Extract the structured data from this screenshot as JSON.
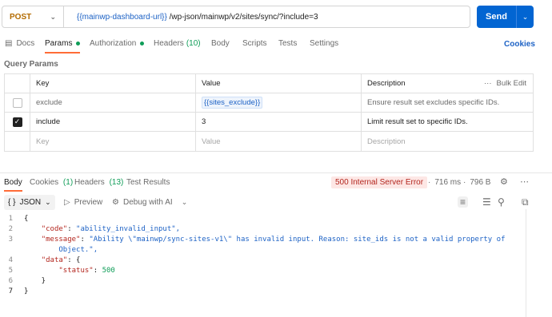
{
  "request": {
    "method": "POST",
    "url_variable": "{{mainwp-dashboard-url}}",
    "url_rest": "/wp-json/mainwp/v2/sites/sync/?include=3",
    "send_label": "Send"
  },
  "tabs": [
    {
      "label": "Docs"
    },
    {
      "label": "Params"
    },
    {
      "label": "Authorization"
    },
    {
      "label": "Headers",
      "count": "(10)"
    },
    {
      "label": "Body"
    },
    {
      "label": "Scripts"
    },
    {
      "label": "Tests"
    },
    {
      "label": "Settings"
    }
  ],
  "cookies_link": "Cookies",
  "query_params": {
    "title": "Query Params",
    "headers": {
      "key": "Key",
      "value": "Value",
      "description": "Description",
      "bulk_edit": "Bulk Edit"
    },
    "rows": [
      {
        "checked": false,
        "key": "exclude",
        "value": "{{sites_exclude}}",
        "description": "Ensure result set excludes specific IDs."
      },
      {
        "checked": true,
        "key": "include",
        "value": "3",
        "description": "Limit result set to specific IDs."
      }
    ],
    "placeholder": {
      "key": "Key",
      "value": "Value",
      "description": "Description"
    }
  },
  "response": {
    "tabs": [
      {
        "label": "Body"
      },
      {
        "label": "Cookies",
        "count": "(1)"
      },
      {
        "label": "Headers",
        "count": "(13)"
      },
      {
        "label": "Test Results"
      }
    ],
    "status": "500 Internal Server Error",
    "time": "716 ms",
    "size": "796 B",
    "format": "JSON",
    "preview_label": "Preview",
    "debug_label": "Debug with AI",
    "code_lines": [
      {
        "n": "1",
        "t": "{"
      },
      {
        "n": "2",
        "t": "    \"code\": \"ability_invalid_input\","
      },
      {
        "n": "3",
        "t": "    \"message\": \"Ability \\\"mainwp/sync-sites-v1\\\" has invalid input. Reason: site_ids is not a valid property of"
      },
      {
        "n": "",
        "t": "        Object.\","
      },
      {
        "n": "4",
        "t": "    \"data\": {"
      },
      {
        "n": "5",
        "t": "        \"status\": 500"
      },
      {
        "n": "6",
        "t": "    }"
      },
      {
        "n": "7",
        "t": "}"
      }
    ]
  }
}
